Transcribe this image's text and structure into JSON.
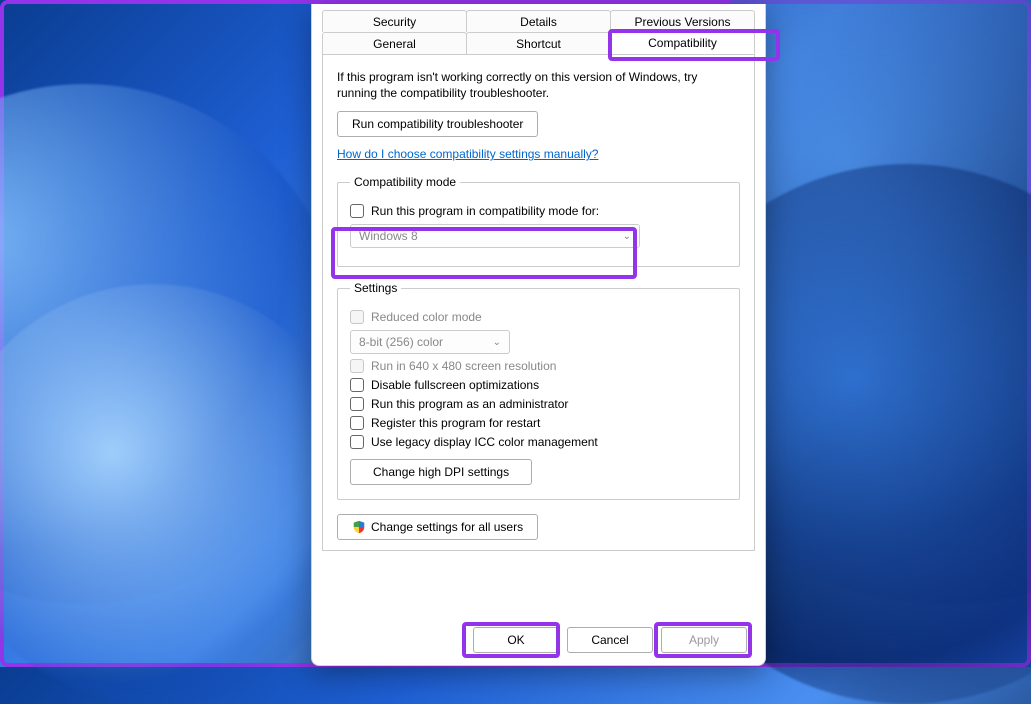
{
  "tabs_row1": [
    "Security",
    "Details",
    "Previous Versions"
  ],
  "tabs_row2": [
    "General",
    "Shortcut",
    "Compatibility"
  ],
  "active_tab": "Compatibility",
  "intro": "If this program isn't working correctly on this version of Windows, try running the compatibility troubleshooter.",
  "troubleshooter_btn": "Run compatibility troubleshooter",
  "help_link": "How do I choose compatibility settings manually?",
  "compat_group": {
    "legend": "Compatibility mode",
    "checkbox": "Run this program in compatibility mode for:",
    "select": "Windows 8"
  },
  "settings_group": {
    "legend": "Settings",
    "reduced_color": "Reduced color mode",
    "color_select": "8-bit (256) color",
    "run_640": "Run in 640 x 480 screen resolution",
    "disable_fullscreen": "Disable fullscreen optimizations",
    "run_admin": "Run this program as an administrator",
    "register_restart": "Register this program for restart",
    "legacy_icc": "Use legacy display ICC color management",
    "dpi_btn": "Change high DPI settings"
  },
  "all_users_btn": "Change settings for all users",
  "buttons": {
    "ok": "OK",
    "cancel": "Cancel",
    "apply": "Apply"
  }
}
